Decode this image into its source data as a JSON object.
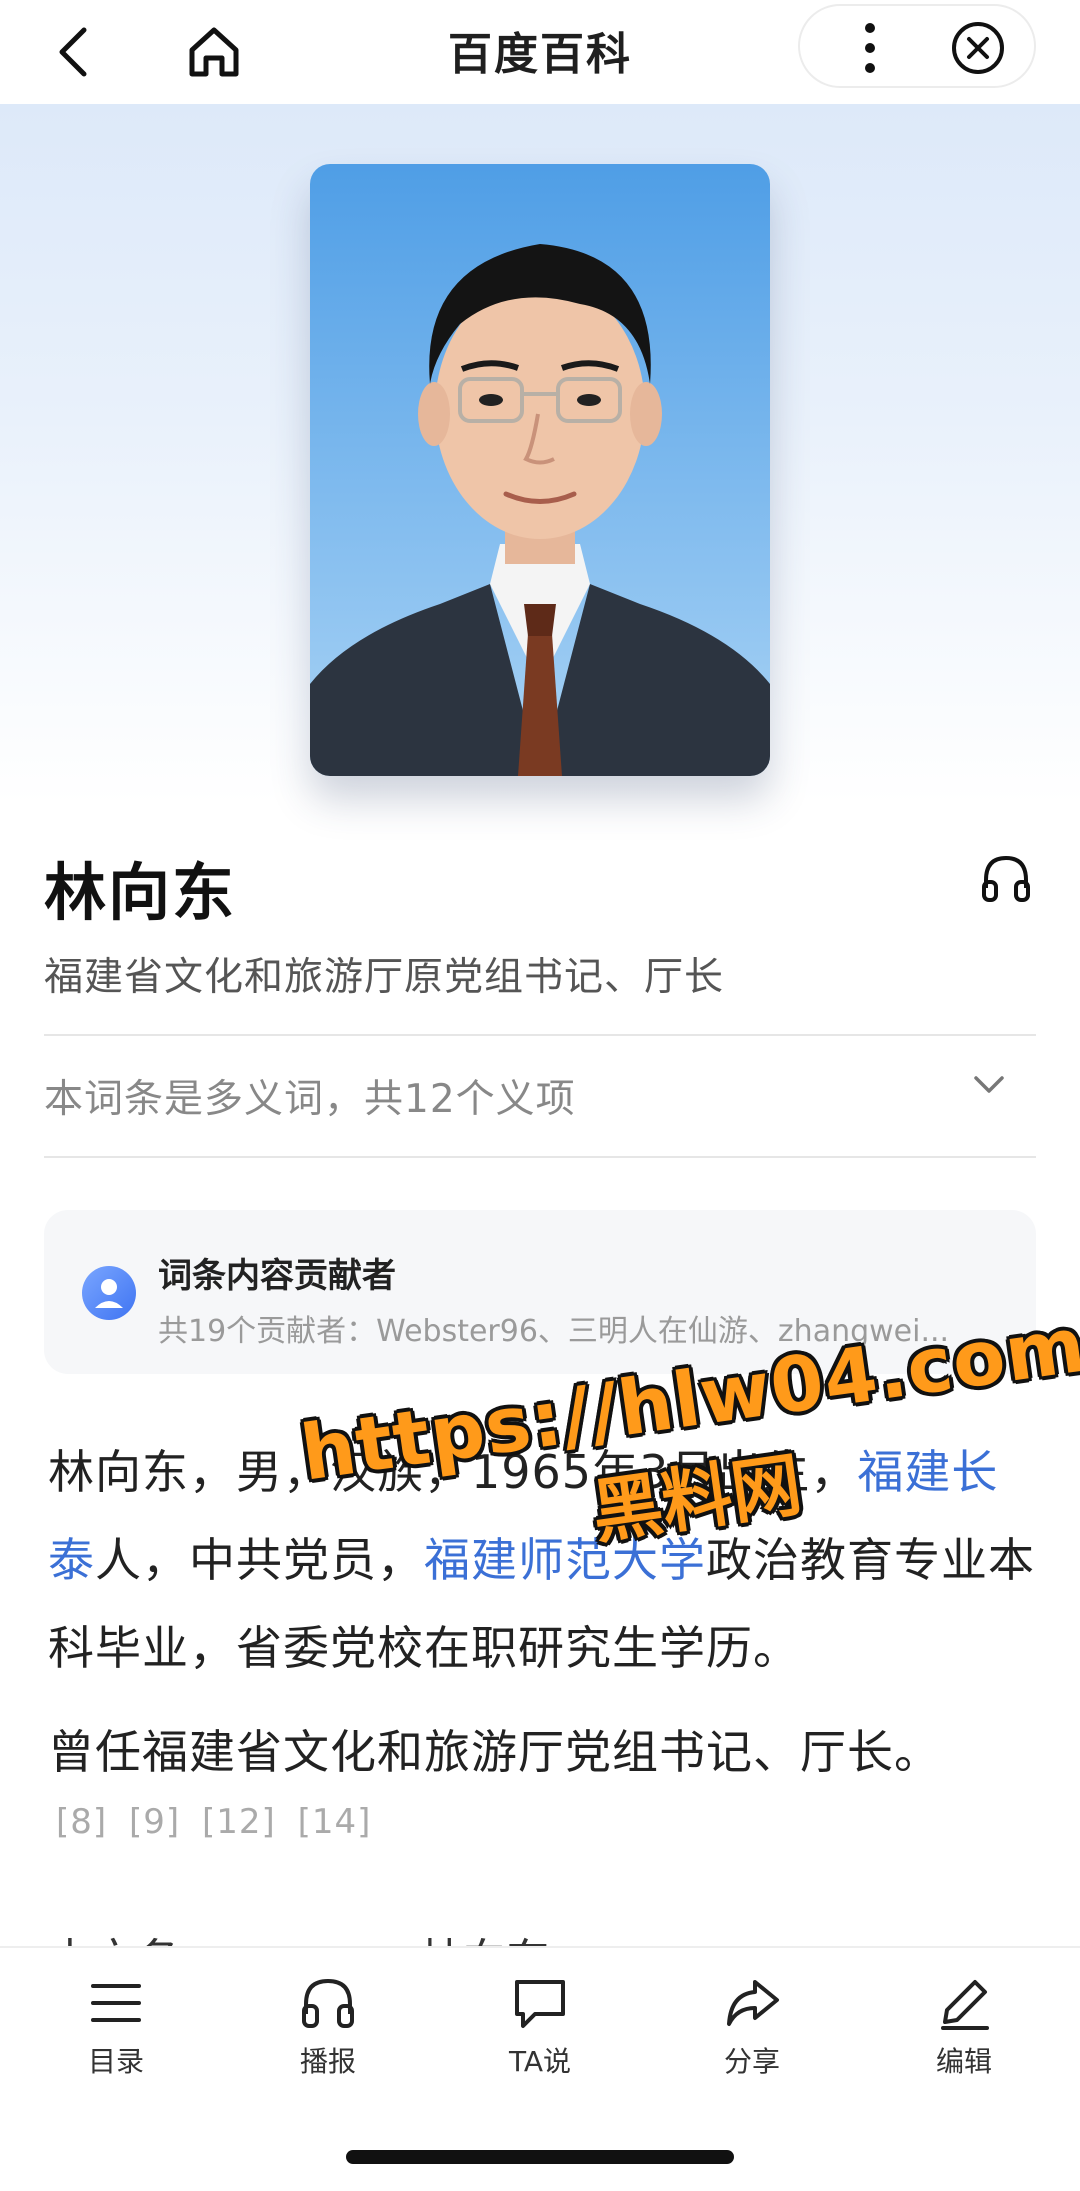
{
  "nav": {
    "title": "百度百科",
    "icons": [
      "back-icon",
      "home-icon",
      "more-icon",
      "close-circle-icon"
    ]
  },
  "entry": {
    "title": "林向东",
    "subtitle": "福建省文化和旅游厅原党组书记、厅长",
    "polysemy": "本词条是多义词，共12个义项"
  },
  "contributors": {
    "title": "词条内容贡献者",
    "summary": "共19个贡献者：Webster96、三明人在仙游、zhangwei..."
  },
  "summary": {
    "p1_a": "林向东，男，汉族，1965年3月出生，",
    "p1_link1": "福建长泰",
    "p1_b": "人，中共党员，",
    "p1_link2": "福建师范大学",
    "p1_c": "政治教育专业本科毕业，省委党校在职研究生学历。",
    "p2": "曾任福建省文化和旅游厅党组书记、厅长。",
    "refs": [
      "[8]",
      "[9]",
      "[12]",
      "[14]"
    ]
  },
  "basic_info": {
    "label": "中文名",
    "value": "林向东"
  },
  "watermark": {
    "line1": "https://hlw04.com",
    "line2": "黑料网"
  },
  "toolbar": {
    "items": [
      {
        "label": "目录",
        "icon": "list-icon"
      },
      {
        "label": "播报",
        "icon": "headphones-icon"
      },
      {
        "label": "TA说",
        "icon": "chat-bubble-icon"
      },
      {
        "label": "分享",
        "icon": "share-icon"
      },
      {
        "label": "编辑",
        "icon": "edit-pencil-icon"
      }
    ]
  },
  "colors": {
    "link": "#3b70d6",
    "watermark": "#ff9a1a",
    "hero_gradient_top": "#dde9f9"
  }
}
